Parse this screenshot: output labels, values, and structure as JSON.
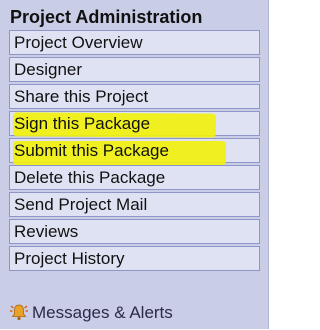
{
  "panel": {
    "title": "Project Administration"
  },
  "menu": {
    "items": [
      {
        "label": "Project Overview"
      },
      {
        "label": "Designer"
      },
      {
        "label": "Share this Project"
      },
      {
        "label": "Sign this Package",
        "highlighted": true
      },
      {
        "label": "Submit this Package",
        "highlighted": true
      },
      {
        "label": "Delete this Package"
      },
      {
        "label": "Send Project Mail"
      },
      {
        "label": "Reviews"
      },
      {
        "label": "Project History"
      }
    ]
  },
  "footer": {
    "icon": "bell-alert-icon",
    "label": "Messages & Alerts"
  },
  "colors": {
    "panel_bg": "#c9cde6",
    "item_bg": "#dfe2f2",
    "item_border": "#8f95c7",
    "highlight": "#f2f20a"
  }
}
